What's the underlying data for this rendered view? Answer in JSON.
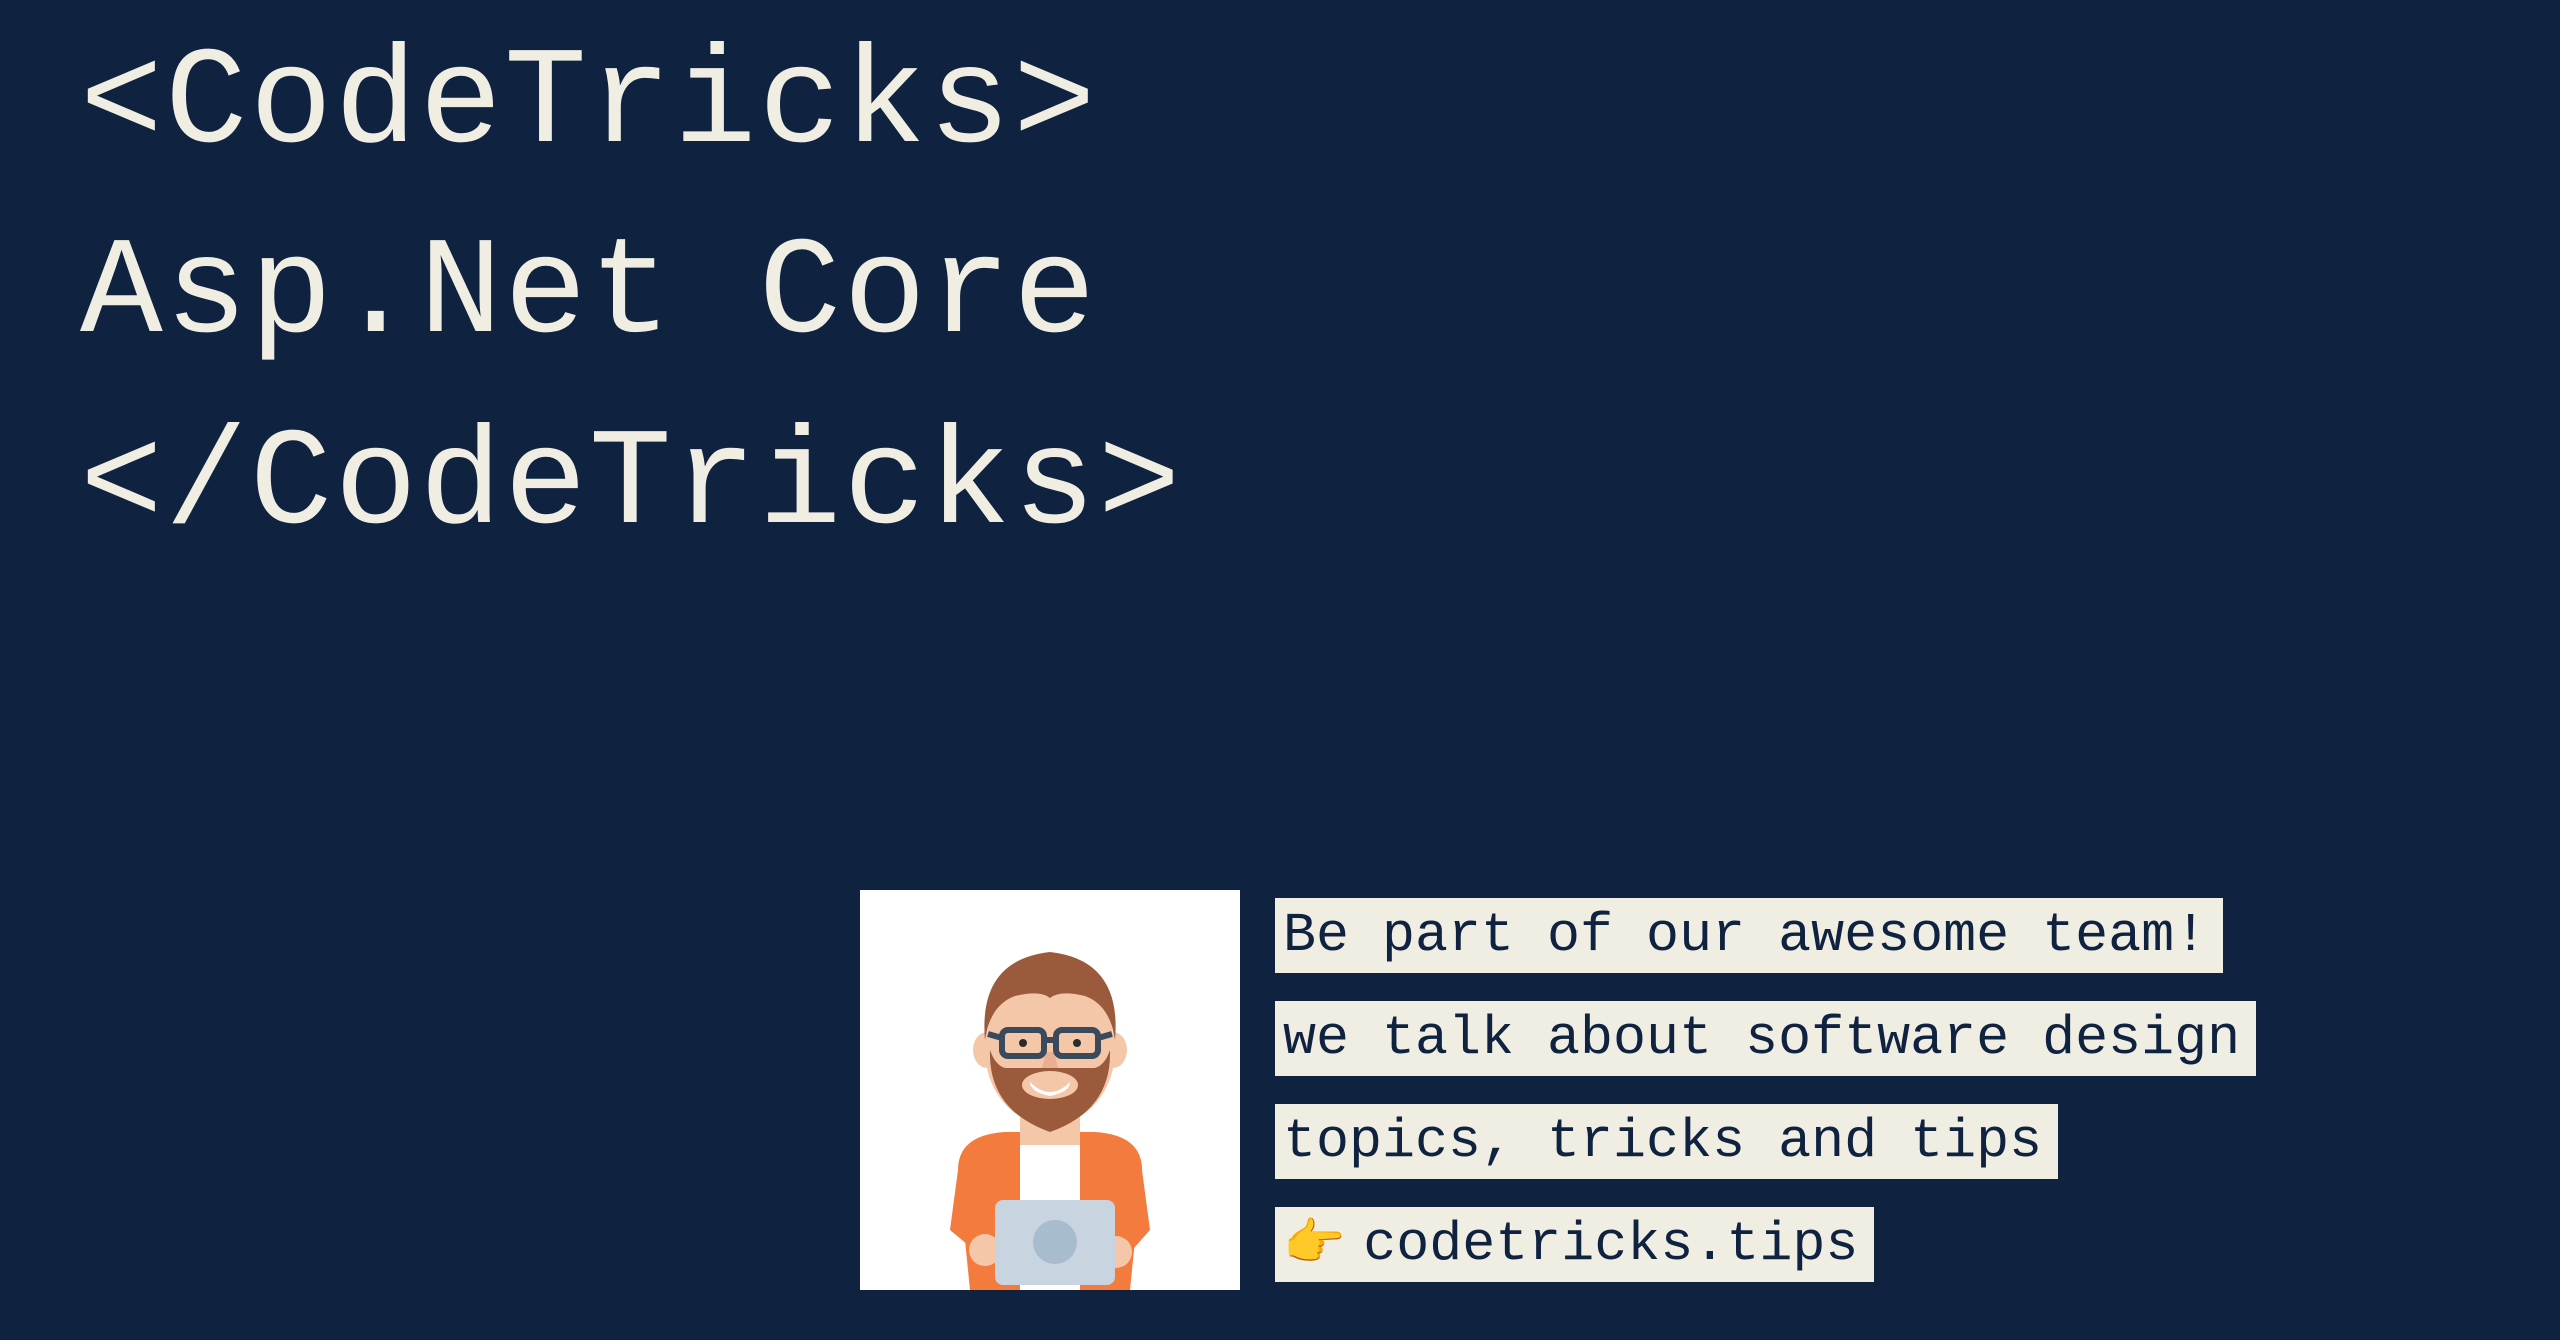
{
  "header": {
    "line1": "<CodeTricks>",
    "line2": "Asp.Net Core",
    "line3": "</CodeTricks>"
  },
  "promo": {
    "line1": "Be part of our awesome team!",
    "line2": "we talk about software design",
    "line3": "topics, tricks and tips",
    "pointer_icon": "👉",
    "site": "codetricks.tips"
  },
  "colors": {
    "background": "#0f2240",
    "text_cream": "#f0ede3",
    "avatar_hair": "#9b5a3c",
    "avatar_skin": "#f4c7a8",
    "avatar_shirt": "#f47b3e",
    "avatar_tshirt": "#ffffff",
    "avatar_glasses": "#3a4a5c",
    "avatar_laptop": "#c8d4e0"
  }
}
